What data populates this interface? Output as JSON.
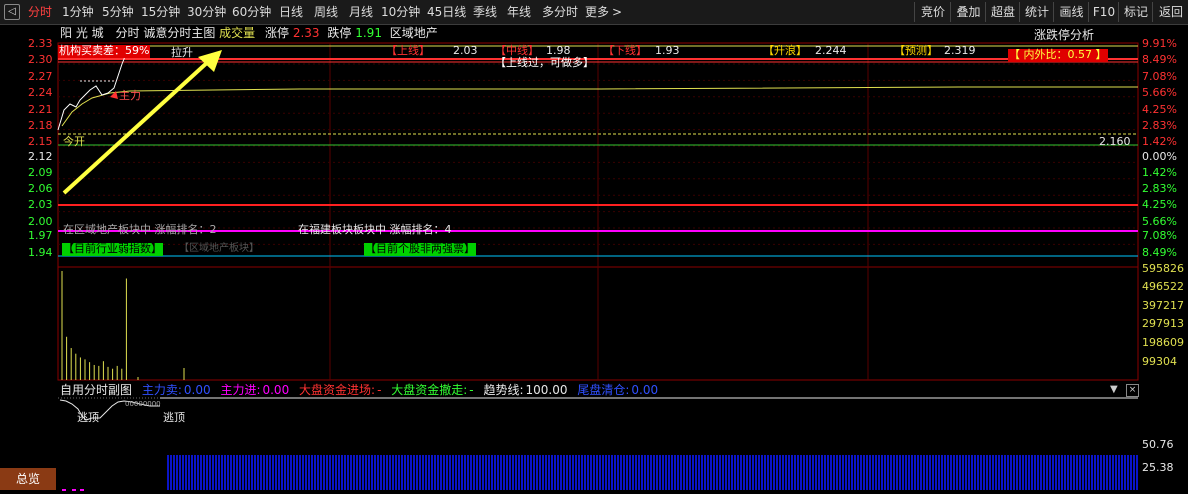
{
  "toolbar": {
    "back_icon": "back-arrow-icon",
    "periods": [
      "分时",
      "1分钟",
      "5分钟",
      "15分钟",
      "30分钟",
      "60分钟",
      "日线",
      "周线",
      "月线",
      "10分钟",
      "45日线",
      "季线",
      "年线",
      "多分时",
      "更多"
    ],
    "more_chevron": ">",
    "right_buttons": [
      "竞价",
      "叠加",
      "超盘",
      "统计",
      "画线",
      "F10",
      "标记",
      "返回"
    ]
  },
  "header": {
    "stock_name": "阳 光 城",
    "mode": "分时",
    "indicator": "诚意分时主图",
    "volume_label": "成交量",
    "limit_up_label": "涨停",
    "limit_up_value": "2.33",
    "limit_down_label": "跌停",
    "limit_down_value": "1.91",
    "sector": "区域地产",
    "analysis": "涨跌停分析"
  },
  "overlays": {
    "inst_label": "机构买卖差：59%",
    "pull_up": "拉升",
    "main_force": "主力",
    "today_open": "今开",
    "upper_label": "【上线】",
    "upper_value": "2.03",
    "middle_label": "【中线】",
    "middle_value": "1.98",
    "lower_label": "【下线】",
    "lower_value": "1.93",
    "rise_wave_label": "【升浪】",
    "rise_wave_value": "2.244",
    "forecast_label": "【预测】",
    "forecast_value": "2.319",
    "inner_outer": "【 内外比：0.57 】",
    "advice": "【上线过，可做多】",
    "open_value": "2.160",
    "sector_rank": "在区域地产板块中 涨幅排名：2",
    "province_rank": "在福建板块板块中 涨幅排名：4",
    "sector_weak": "【目前行业弱指数】",
    "sector_board": "【区域地产板块】",
    "not_strong": "【目前个股非两强票】"
  },
  "price_axis": [
    "2.33",
    "2.30",
    "2.27",
    "2.24",
    "2.21",
    "2.18",
    "2.15",
    "2.12",
    "2.09",
    "2.06",
    "2.03",
    "2.00",
    "1.97",
    "1.94"
  ],
  "pct_axis": [
    "9.91%",
    "8.49%",
    "7.08%",
    "5.66%",
    "4.25%",
    "2.83%",
    "1.42%",
    "0.00%",
    "1.42%",
    "2.83%",
    "4.25%",
    "5.66%",
    "7.08%",
    "8.49%"
  ],
  "volume_axis": [
    "595826",
    "496522",
    "397217",
    "297913",
    "198609",
    "99304"
  ],
  "volume_bars": [
    580000,
    230000,
    170000,
    140000,
    120000,
    110000,
    95000,
    80000,
    75000,
    100000,
    70000,
    60000,
    75000,
    60000,
    540000
  ],
  "sub_indicator": {
    "title": "自用分时副图",
    "main_sell_label": "主力卖:",
    "main_sell_value": "0.00",
    "main_buy_label": "主力进:",
    "main_buy_value": "0.00",
    "market_in_label": "大盘资金进场:",
    "market_in_value": "-",
    "market_out_label": "大盘资金撤走:",
    "market_out_value": "-",
    "trend_label": "趋势线:",
    "trend_value": "100.00",
    "clear_label": "尾盘清仓:",
    "clear_value": "0.00",
    "escape_1": "逃顶",
    "escape_2": "逃顶",
    "tiny_label": "00000000",
    "axis": [
      "50.76",
      "25.38"
    ]
  },
  "summary_button": "总览",
  "colors": {
    "up_red": "#ff3232",
    "down_green": "#32ff32",
    "price_white": "#ffffff",
    "avg_yellow": "#e0e050",
    "magenta": "#ff00ff",
    "cyan": "#00c8ff",
    "blue_bar": "#0a14c8",
    "arrow_yellow": "#ffff40"
  }
}
